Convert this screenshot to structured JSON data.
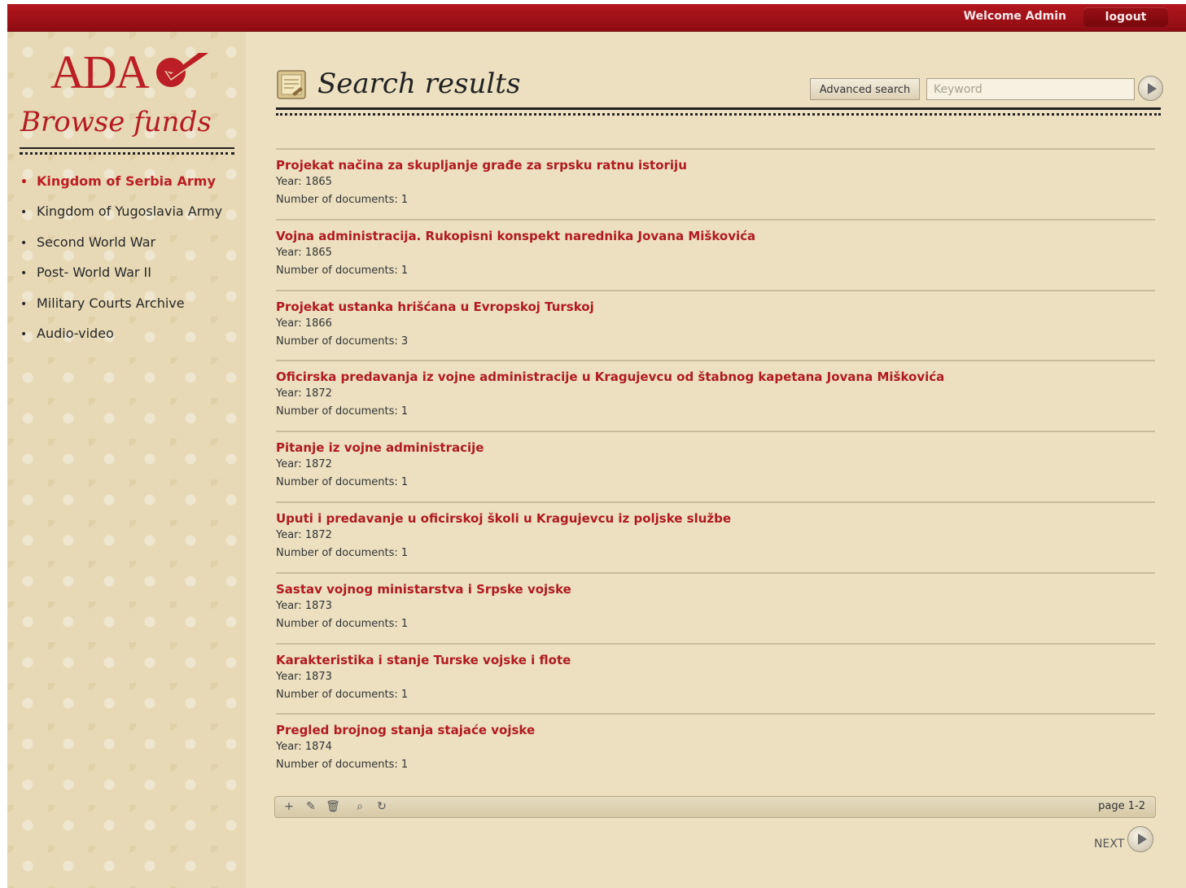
{
  "header": {
    "welcome": "Welcome Admin",
    "logout_label": "logout",
    "brand_color": "#b3161e"
  },
  "sidebar": {
    "logo_text": "ADA",
    "title": "Browse funds",
    "items": [
      {
        "label": "Kingdom of Serbia Army",
        "active": true
      },
      {
        "label": "Kingdom of Yugoslavia Army",
        "active": false
      },
      {
        "label": "Second World War",
        "active": false
      },
      {
        "label": "Post- World War II",
        "active": false
      },
      {
        "label": "Military Courts Archive",
        "active": false
      },
      {
        "label": "Audio-video",
        "active": false
      }
    ]
  },
  "main": {
    "title": "Search results",
    "advanced_search_label": "Advanced search",
    "search_placeholder": "Keyword",
    "search_value": "",
    "year_label": "Year:",
    "docs_label": "Number of documents:",
    "results": [
      {
        "title": "Projekat načina za skupljanje građe za srpsku ratnu istoriju",
        "year": "1865",
        "documents": "1"
      },
      {
        "title": "Vojna administracija. Rukopisni konspekt narednika Jovana Miškovića",
        "year": "1865",
        "documents": "1"
      },
      {
        "title": "Projekat ustanka hrišćana u Evropskoj Turskoj",
        "year": "1866",
        "documents": "3"
      },
      {
        "title": "Oficirska predavanja iz vojne administracije u Kragujevcu od štabnog kapetana Jovana Miškovića",
        "year": "1872",
        "documents": "1"
      },
      {
        "title": "Pitanje iz vojne administracije",
        "year": "1872",
        "documents": "1"
      },
      {
        "title": "Uputi i predavanje u oficirskoj školi u Kragujevcu iz poljske službe",
        "year": "1872",
        "documents": "1"
      },
      {
        "title": "Sastav vojnog ministarstva i Srpske vojske",
        "year": "1873",
        "documents": "1"
      },
      {
        "title": "Karakteristika i stanje Turske vojske i flote",
        "year": "1873",
        "documents": "1"
      },
      {
        "title": "Pregled brojnog stanja stajaće vojske",
        "year": "1874",
        "documents": "1"
      }
    ],
    "toolbar": {
      "icons": [
        "add-icon",
        "edit-icon",
        "delete-icon",
        "search-icon",
        "refresh-icon"
      ],
      "page_info": "page 1-2"
    },
    "next_label": "NEXT"
  }
}
